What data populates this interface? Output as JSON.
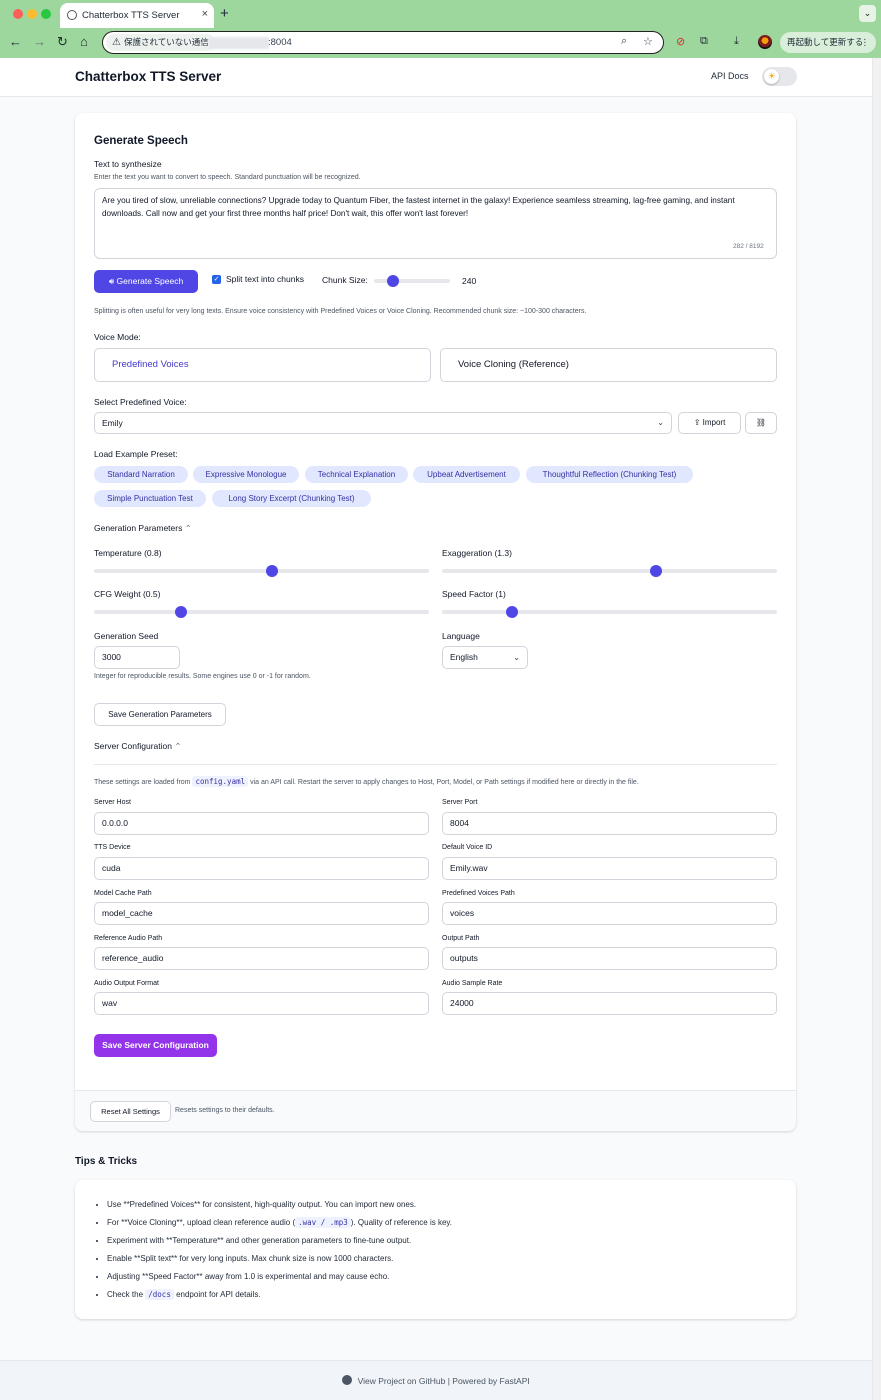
{
  "browser": {
    "tab_title": "Chatterbox TTS Server",
    "tab_close": "×",
    "new_tab": "+",
    "security_label": "保護されていない通信",
    "url_visible": ":8004",
    "restart_label": "再起動して更新する",
    "restart_menu": "⋮"
  },
  "header": {
    "title": "Chatterbox TTS Server",
    "api_docs": "API Docs"
  },
  "generate": {
    "title": "Generate Speech",
    "text_label": "Text to synthesize",
    "text_help": "Enter the text you want to convert to speech. Standard punctuation will be recognized.",
    "text_value": "Are you tired of slow, unreliable connections? Upgrade today to Quantum Fiber, the fastest internet in the galaxy! Experience seamless streaming, lag-free gaming, and instant downloads. Call now and get your first three months half price! Don't wait, this offer won't last forever!",
    "char_count": "282 / 8192",
    "generate_button": "Generate Speech",
    "split_label": "Split text into chunks",
    "split_checked": true,
    "chunk_size_label": "Chunk Size:",
    "chunk_size_value": "240",
    "chunk_size_fraction": 0.25,
    "split_help": "Splitting is often useful for very long texts. Ensure voice consistency with Predefined Voices or Voice Cloning. Recommended chunk size: ~100-300 characters."
  },
  "voice_mode": {
    "label": "Voice Mode:",
    "predefined": "Predefined Voices",
    "cloning": "Voice Cloning (Reference)",
    "selected": "predefined"
  },
  "predefined_voice": {
    "label": "Select Predefined Voice:",
    "selected": "Emily",
    "import_button": "Import"
  },
  "presets": {
    "label": "Load Example Preset:",
    "items": [
      "Standard Narration",
      "Expressive Monologue",
      "Technical Explanation",
      "Upbeat Advertisement",
      "Thoughtful Reflection (Chunking Test)",
      "Simple Punctuation Test",
      "Long Story Excerpt (Chunking Test)"
    ]
  },
  "generation_params": {
    "title": "Generation Parameters",
    "temperature_label": "Temperature (0.8)",
    "temperature_fraction": 0.53,
    "exaggeration_label": "Exaggeration (1.3)",
    "exaggeration_fraction": 0.64,
    "cfg_label": "CFG Weight (0.5)",
    "cfg_fraction": 0.26,
    "speed_label": "Speed Factor (1)",
    "speed_fraction": 0.21,
    "seed_label": "Generation Seed",
    "seed_value": "3000",
    "seed_help": "Integer for reproducible results. Some engines use 0 or -1 for random.",
    "language_label": "Language",
    "language_value": "English",
    "save_button": "Save Generation Parameters"
  },
  "server_config": {
    "title": "Server Configuration",
    "help_prefix": "These settings are loaded from",
    "help_code": "config.yaml",
    "help_suffix": "via an API call. Restart the server to apply changes to Host, Port, Model, or Path settings if modified here or directly in the file.",
    "fields": {
      "host_label": "Server Host",
      "host_value": "0.0.0.0",
      "port_label": "Server Port",
      "port_value": "8004",
      "device_label": "TTS Device",
      "device_value": "cuda",
      "voice_id_label": "Default Voice ID",
      "voice_id_value": "Emily.wav",
      "cache_label": "Model Cache Path",
      "cache_value": "model_cache",
      "voices_path_label": "Predefined Voices Path",
      "voices_path_value": "voices",
      "ref_label": "Reference Audio Path",
      "ref_value": "reference_audio",
      "output_label": "Output Path",
      "output_value": "outputs",
      "format_label": "Audio Output Format",
      "format_value": "wav",
      "rate_label": "Audio Sample Rate",
      "rate_value": "24000"
    },
    "save_button": "Save Server Configuration"
  },
  "reset": {
    "button": "Reset All Settings",
    "help": "Resets settings to their defaults."
  },
  "tips": {
    "title": "Tips & Tricks",
    "t1": "Use **Predefined Voices** for consistent, high-quality output. You can import new ones.",
    "t2_pre": "For **Voice Cloning**, upload clean reference audio (",
    "t2_code": ".wav / .mp3",
    "t2_post": "). Quality of reference is key.",
    "t3": "Experiment with **Temperature** and other generation parameters to fine-tune output.",
    "t4": "Enable **Split text** for very long inputs. Max chunk size is now 1000 characters.",
    "t5": "Adjusting **Speed Factor** away from 1.0 is experimental and may cause echo.",
    "t6_pre": "Check the",
    "t6_code": "/docs",
    "t6_post": "endpoint for API details."
  },
  "footer": {
    "github_link": "View Project on GitHub",
    "separator": "|",
    "powered_by": "Powered by FastAPI"
  },
  "colors": {
    "primary": "#4f46e5",
    "purple": "#9333ea",
    "chip_bg": "#e0e7ff",
    "browser_chrome": "#9dd79d"
  }
}
